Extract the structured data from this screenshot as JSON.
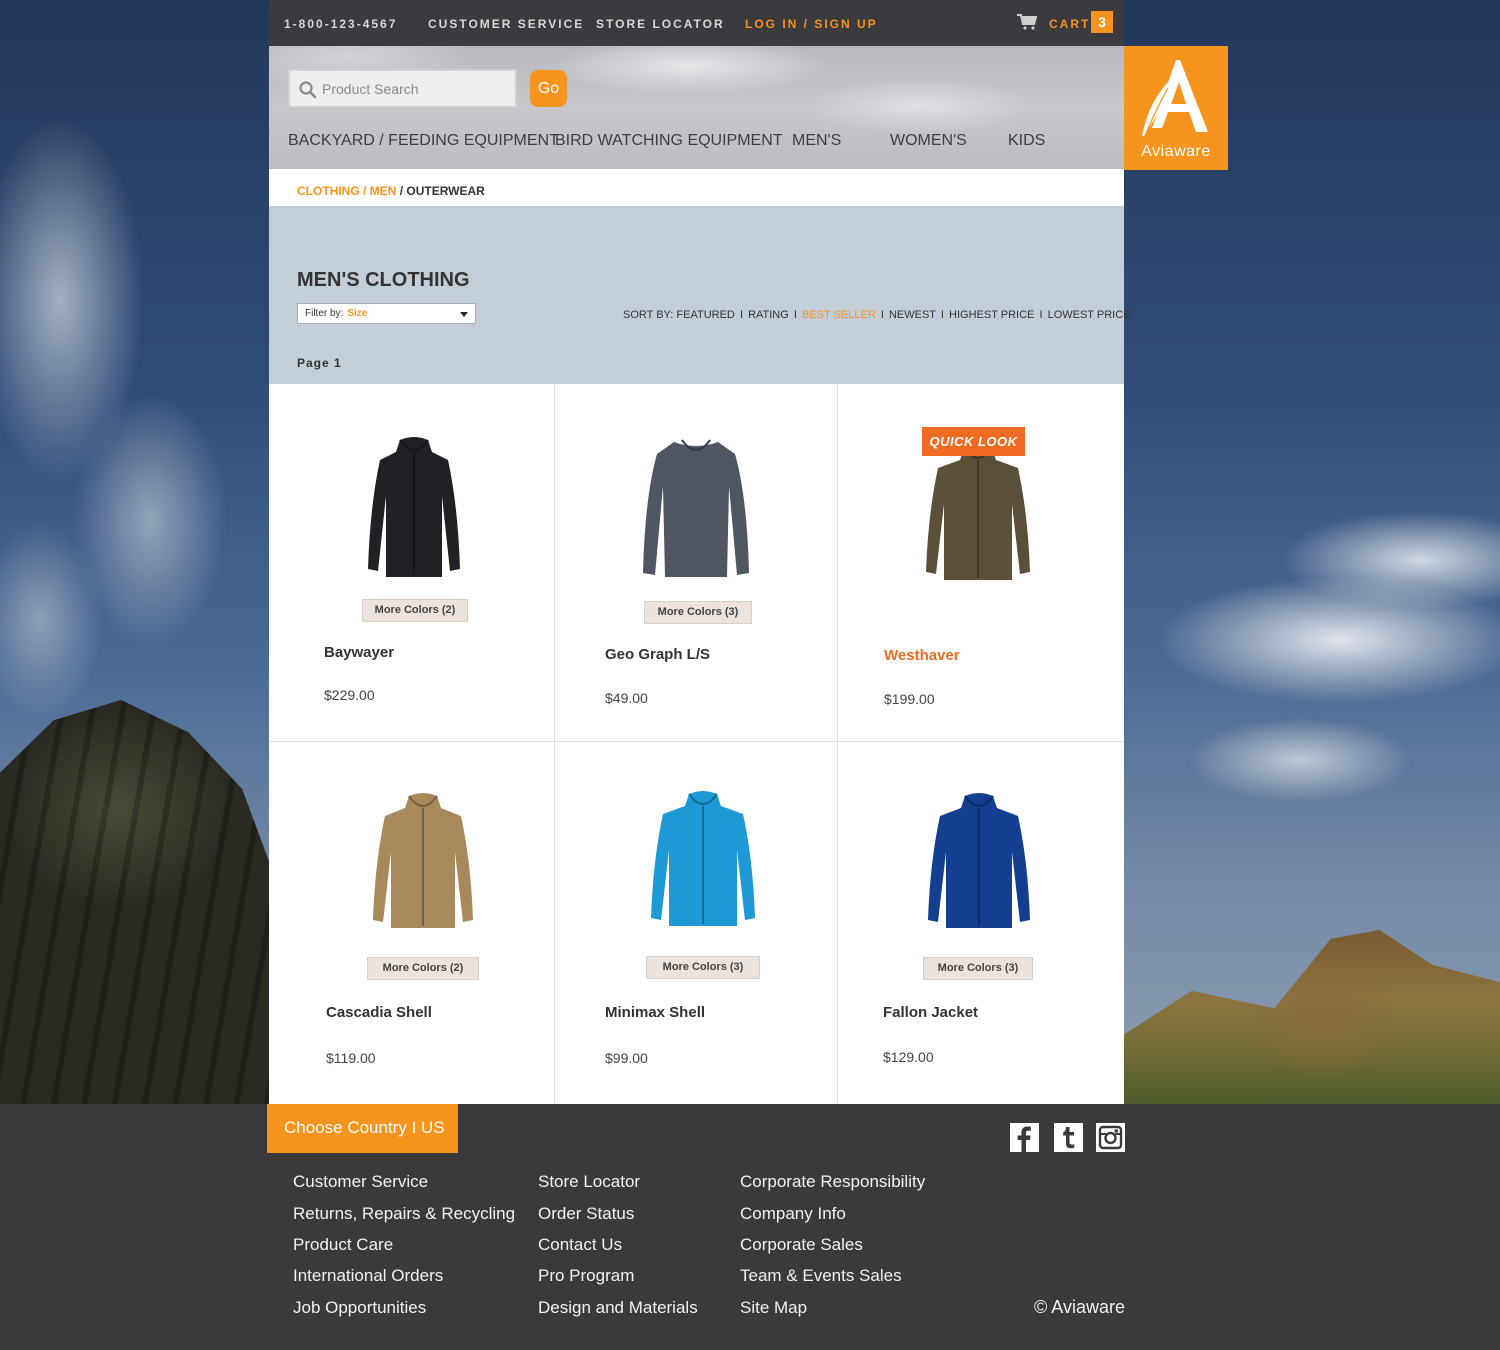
{
  "topbar": {
    "phone": "1-800-123-4567",
    "customer_service": "CUSTOMER SERVICE",
    "store_locator": "STORE LOCATOR",
    "login": "LOG IN / SIGN UP",
    "cart_label": "CART",
    "cart_count": "3"
  },
  "search": {
    "placeholder": "Product Search",
    "go_label": "Go"
  },
  "nav": {
    "items": [
      "BACKYARD / FEEDING EQUIPMENT",
      "BIRD WATCHING EQUIPMENT",
      "MEN'S",
      "WOMEN'S",
      "KIDS"
    ]
  },
  "logo": {
    "text": "Aviaware",
    "letter": "A"
  },
  "breadcrumb": {
    "items": [
      "CLOTHING",
      "MEN",
      "OUTERWEAR"
    ],
    "separator": " / "
  },
  "category": {
    "title": "MEN'S CLOTHING",
    "filter_label": "Filter by:",
    "filter_value": "Size",
    "sort_prefix": "SORT BY:",
    "sort_options": [
      "FEATURED",
      "RATING",
      "BEST SELLER",
      "NEWEST",
      "HIGHEST PRICE",
      "LOWEST PRICE"
    ],
    "sort_active": "BEST SELLER",
    "sort_separator": "I",
    "page": "Page 1"
  },
  "products": [
    {
      "name": "Baywayer",
      "price": "$229.00",
      "colors": "More Colors (2)",
      "color": "#1f2124"
    },
    {
      "name": "Geo Graph L/S",
      "price": "$49.00",
      "colors": "More Colors (3)",
      "color": "#4f5563"
    },
    {
      "name": "Westhaver",
      "price": "$199.00",
      "colors": "",
      "color": "#5c4f3a",
      "quick_look": "QUICK LOOK",
      "highlight": true
    },
    {
      "name": "Cascadia Shell",
      "price": "$119.00",
      "colors": "More Colors (2)",
      "color": "#a8895c"
    },
    {
      "name": "Minimax Shell",
      "price": "$99.00",
      "colors": "More Colors (3)",
      "color": "#1d9ad6"
    },
    {
      "name": "Fallon Jacket",
      "price": "$129.00",
      "colors": "More Colors (3)",
      "color": "#143e8f"
    }
  ],
  "footer": {
    "country": "Choose Country I US",
    "col1": [
      "Customer Service",
      "Returns, Repairs & Recycling",
      "Product Care",
      "International Orders",
      "Job Opportunities"
    ],
    "col2": [
      "Store Locator",
      "Order Status",
      "Contact Us",
      "Pro Program",
      "Design and Materials"
    ],
    "col3": [
      "Corporate Responsibility",
      "Company Info",
      "Corporate Sales",
      "Team & Events Sales",
      "Site Map"
    ],
    "copyright": "© Aviaware"
  },
  "colors": {
    "accent": "#f7941d",
    "accent_strong": "#f06a22",
    "dark_bar": "#3b3b3f",
    "category_bg": "#c4ced8"
  }
}
